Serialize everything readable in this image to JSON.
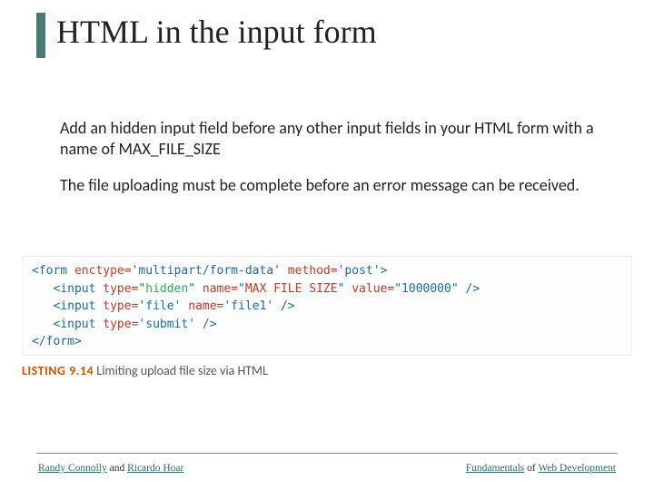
{
  "title": "HTML in the input form",
  "paragraphs": [
    "Add an hidden input field before any other input fields in your HTML form with a name of MAX_FILE_SIZE",
    "The file uploading must be complete before an error message can be received."
  ],
  "code": {
    "line1_open": "<form",
    "line1_attr1": " enctype=",
    "line1_val1": "'multipart/form-data'",
    "line1_attr2": " method=",
    "line1_val2": "'post'",
    "line1_close": ">",
    "line2_open": "<input",
    "line2_attr1": " type=",
    "line2_val1_q1": "\"",
    "line2_val1_hl": "hidden",
    "line2_val1_q2": "\"",
    "line2_attr2": " name=",
    "line2_val2_q1": "\"",
    "line2_val2_hl": "MAX FILE SIZE",
    "line2_val2_q2": "\"",
    "line2_attr3": " value=",
    "line2_val3": "\"1000000\"",
    "line2_close": " />",
    "line3_open": "<input",
    "line3_attr1": " type=",
    "line3_val1": "'file'",
    "line3_attr2": " name=",
    "line3_val2": "'file1'",
    "line3_close": " />",
    "line4_open": "<input",
    "line4_attr1": " type=",
    "line4_val1": "'submit'",
    "line4_close": " />",
    "line5": "</form>"
  },
  "listing": {
    "num": "LISTING 9.14",
    "caption": " Limiting upload file size via HTML"
  },
  "footer": {
    "author1": "Randy Connolly",
    "and": " and ",
    "author2": "Ricardo Hoar",
    "book1": "Fundamentals",
    "of": " of ",
    "book2": "Web Development"
  }
}
